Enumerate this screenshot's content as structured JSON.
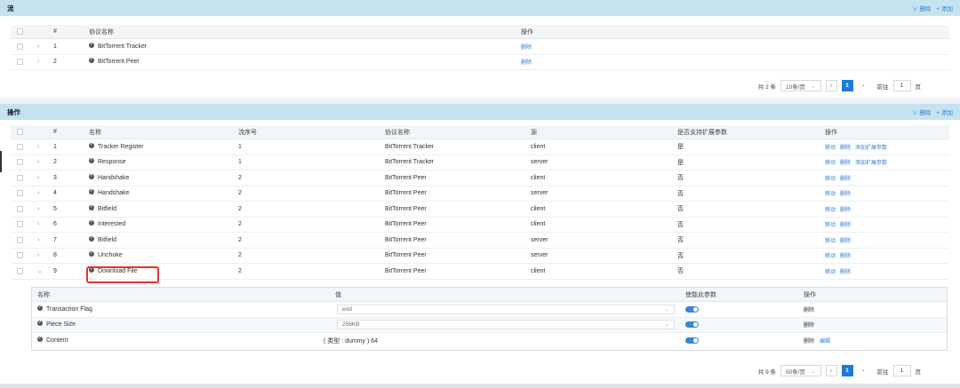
{
  "streams": {
    "title": "流",
    "actions": {
      "delete": "删除",
      "add": "添加"
    },
    "columns": {
      "index": "#",
      "protocol": "协议名称",
      "ops": "操作"
    },
    "rows": [
      {
        "index": "1",
        "protocol": "BitTorrent Tracker",
        "op": "删除"
      },
      {
        "index": "2",
        "protocol": "BitTorrent Peer",
        "op": "删除"
      }
    ],
    "pager": {
      "total": "共 2 条",
      "page_size": "10条/页",
      "current": "1",
      "goto_label": "前往",
      "goto_value": "1",
      "page_unit": "页"
    }
  },
  "operations": {
    "title": "操作",
    "actions": {
      "delete": "删除",
      "add": "添加"
    },
    "columns": {
      "index": "#",
      "name": "名称",
      "seq": "流序号",
      "protocol": "协议名称",
      "source": "源",
      "ext": "是否支持扩展参数",
      "ops": "操作"
    },
    "rows": [
      {
        "index": "1",
        "name": "Tracker Register",
        "seq": "1",
        "protocol": "BitTorrent Tracker",
        "source": "client",
        "ext": "是",
        "ops": [
          "移动",
          "删除",
          "添加扩展参数"
        ]
      },
      {
        "index": "2",
        "name": "Response",
        "seq": "1",
        "protocol": "BitTorrent Tracker",
        "source": "server",
        "ext": "是",
        "ops": [
          "移动",
          "删除",
          "添加扩展参数"
        ]
      },
      {
        "index": "3",
        "name": "Handshake",
        "seq": "2",
        "protocol": "BitTorrent Peer",
        "source": "client",
        "ext": "否",
        "ops": [
          "移动",
          "删除"
        ]
      },
      {
        "index": "4",
        "name": "Handshake",
        "seq": "2",
        "protocol": "BitTorrent Peer",
        "source": "server",
        "ext": "否",
        "ops": [
          "移动",
          "删除"
        ]
      },
      {
        "index": "5",
        "name": "Bitfield",
        "seq": "2",
        "protocol": "BitTorrent Peer",
        "source": "client",
        "ext": "否",
        "ops": [
          "移动",
          "删除"
        ]
      },
      {
        "index": "6",
        "name": "Interested",
        "seq": "2",
        "protocol": "BitTorrent Peer",
        "source": "client",
        "ext": "否",
        "ops": [
          "移动",
          "删除"
        ]
      },
      {
        "index": "7",
        "name": "Bitfield",
        "seq": "2",
        "protocol": "BitTorrent Peer",
        "source": "server",
        "ext": "否",
        "ops": [
          "移动",
          "删除"
        ]
      },
      {
        "index": "8",
        "name": "Unchoke",
        "seq": "2",
        "protocol": "BitTorrent Peer",
        "source": "server",
        "ext": "否",
        "ops": [
          "移动",
          "删除"
        ]
      },
      {
        "index": "9",
        "name": "Download File",
        "seq": "2",
        "protocol": "BitTorrent Peer",
        "source": "client",
        "ext": "否",
        "ops": [
          "移动",
          "删除"
        ]
      }
    ],
    "params": {
      "columns": {
        "name": "名称",
        "value": "值",
        "toggle": "使能此参数",
        "ops": "操作"
      },
      "rows": [
        {
          "name": "Transaction Flag",
          "value": "end",
          "ops": [
            "删除"
          ]
        },
        {
          "name": "Piece Size",
          "value": "256KB",
          "ops": [
            "删除"
          ]
        },
        {
          "name": "Content",
          "value": "( 类型 : dummy ) 64",
          "ops": [
            "删除",
            "编辑"
          ]
        }
      ]
    },
    "pager": {
      "total": "共 9 条",
      "page_size": "50条/页",
      "current": "1",
      "goto_label": "前往",
      "goto_value": "1",
      "page_unit": "页"
    }
  },
  "colors": {
    "header_band": "#c5e3ef",
    "link": "#2f7fd4",
    "active_page": "#1d7bd8",
    "highlight": "#e5322d"
  }
}
